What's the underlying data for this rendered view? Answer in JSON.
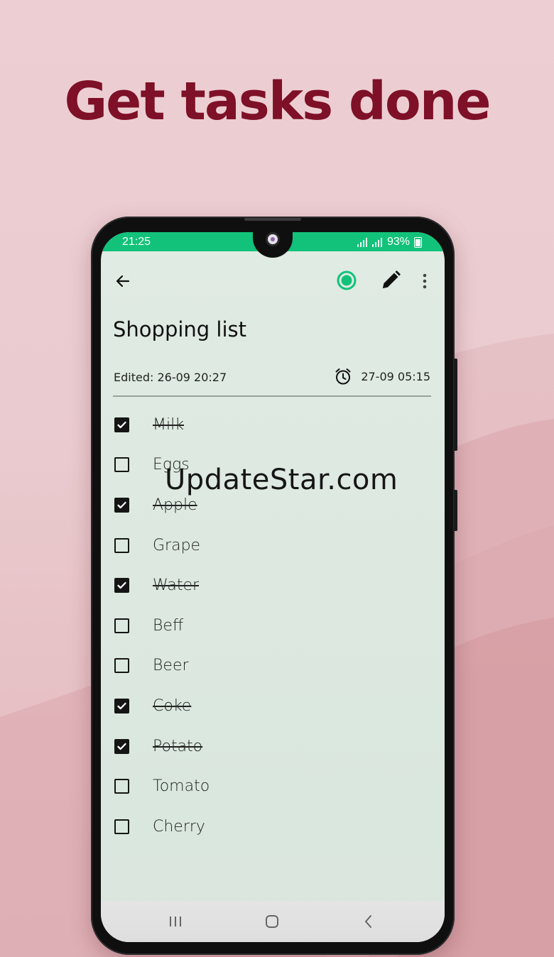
{
  "headline": "Get tasks done",
  "watermark": "UpdateStar.com",
  "status_bar": {
    "time": "21:25",
    "battery": "93%"
  },
  "note": {
    "title": "Shopping list",
    "edited": "Edited: 26-09 20:27",
    "reminder": "27-09 05:15"
  },
  "checklist": [
    {
      "label": "Milk",
      "checked": true
    },
    {
      "label": "Eggs",
      "checked": false
    },
    {
      "label": "Apple",
      "checked": true
    },
    {
      "label": "Grape",
      "checked": false
    },
    {
      "label": "Water",
      "checked": true
    },
    {
      "label": "Beff",
      "checked": false
    },
    {
      "label": "Beer",
      "checked": false
    },
    {
      "label": "Coke",
      "checked": true
    },
    {
      "label": "Potato",
      "checked": true
    },
    {
      "label": "Tomato",
      "checked": false
    },
    {
      "label": "Cherry",
      "checked": false
    }
  ],
  "colors": {
    "headline": "#7e1027",
    "status_bar": "#12c27a",
    "accent_circle": "#12c27a",
    "screen_bg": "#dde8e0"
  },
  "icons": {
    "back": "arrow-left-icon",
    "status": "circle-icon",
    "edit": "pencil-icon",
    "more": "more-vertical-icon",
    "reminder": "alarm-clock-icon",
    "nav_recents": "recents-icon",
    "nav_home": "home-icon",
    "nav_back": "chevron-left-icon"
  }
}
